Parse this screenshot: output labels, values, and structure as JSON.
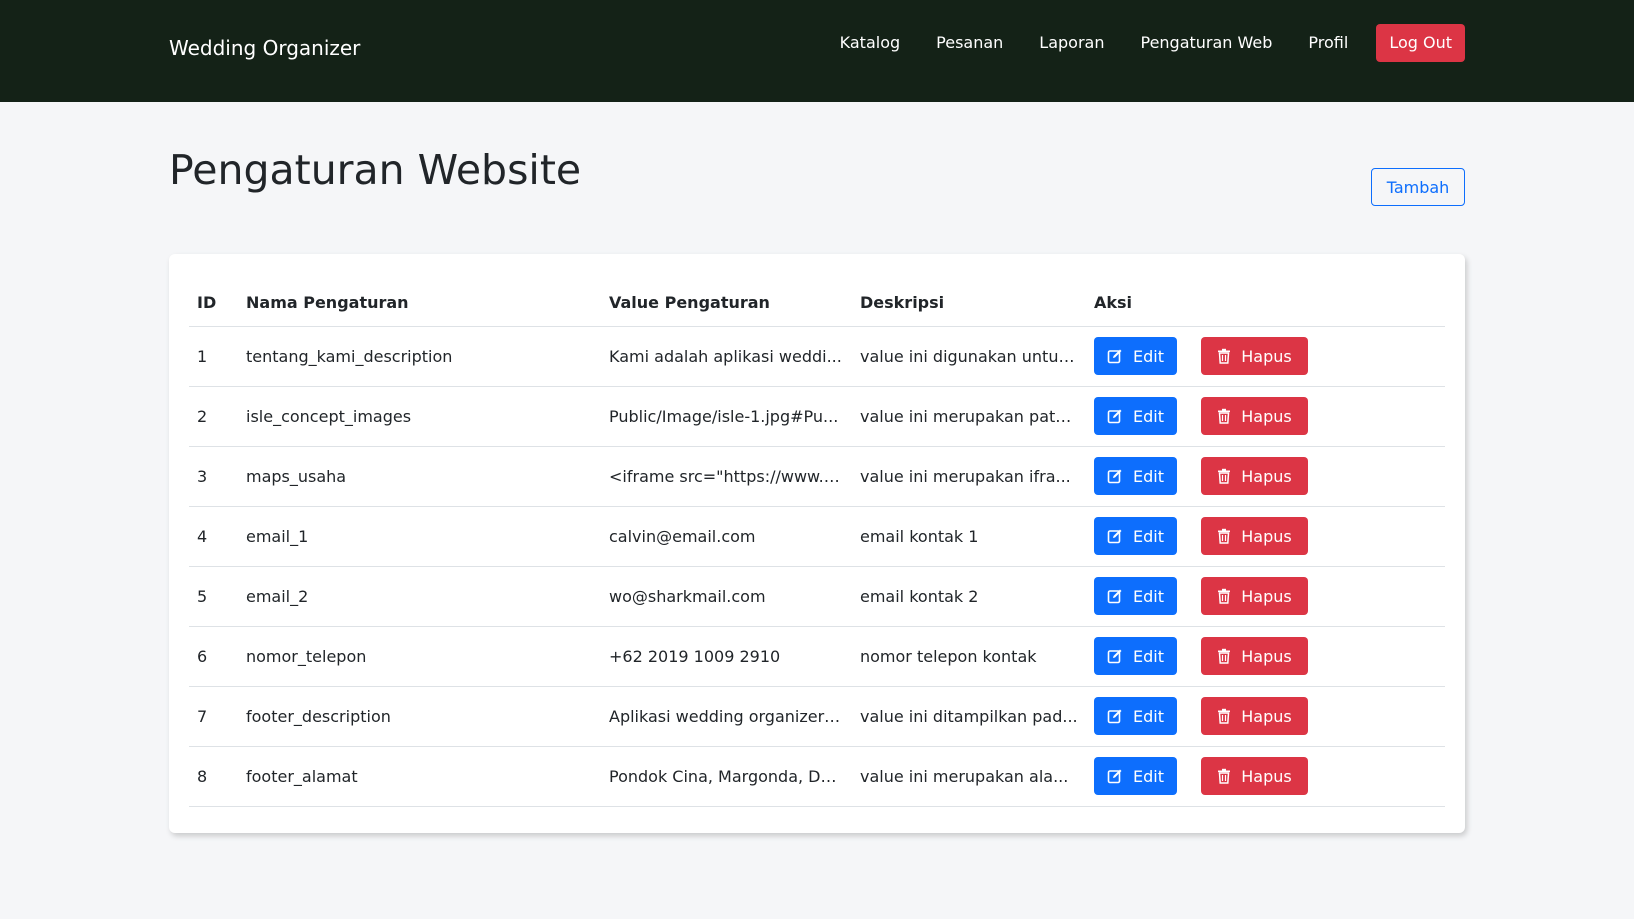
{
  "nav": {
    "brand": "Wedding Organizer",
    "links": [
      "Katalog",
      "Pesanan",
      "Laporan",
      "Pengaturan Web",
      "Profil"
    ],
    "logout": "Log Out"
  },
  "page": {
    "title": "Pengaturan Website",
    "add_button": "Tambah"
  },
  "table": {
    "headers": [
      "ID",
      "Nama Pengaturan",
      "Value Pengaturan",
      "Deskripsi",
      "Aksi"
    ],
    "edit_label": "Edit",
    "delete_label": "Hapus",
    "rows": [
      {
        "id": "1",
        "nama": "tentang_kami_description",
        "value": "Kami adalah aplikasi weddi...",
        "deskripsi": "value ini digunakan untuk..."
      },
      {
        "id": "2",
        "nama": "isle_concept_images",
        "value": "Public/Image/isle-1.jpg#Pu...",
        "deskripsi": "value ini merupakan path..."
      },
      {
        "id": "3",
        "nama": "maps_usaha",
        "value": "<iframe src=\"https://www.g...",
        "deskripsi": "value ini merupakan ifra..."
      },
      {
        "id": "4",
        "nama": "email_1",
        "value": "calvin@email.com",
        "deskripsi": "email kontak 1"
      },
      {
        "id": "5",
        "nama": "email_2",
        "value": "wo@sharkmail.com",
        "deskripsi": "email kontak 2"
      },
      {
        "id": "6",
        "nama": "nomor_telepon",
        "value": "+62 2019 1009 2910",
        "deskripsi": "nomor telepon kontak"
      },
      {
        "id": "7",
        "nama": "footer_description",
        "value": "Aplikasi wedding organizer ...",
        "deskripsi": "value ini ditampilkan pad..."
      },
      {
        "id": "8",
        "nama": "footer_alamat",
        "value": "Pondok Cina, Margonda, De...",
        "deskripsi": "value ini merupakan ala..."
      }
    ]
  },
  "colors": {
    "navbar": "#142217",
    "primary": "#0d6efd",
    "danger": "#dc3545"
  }
}
